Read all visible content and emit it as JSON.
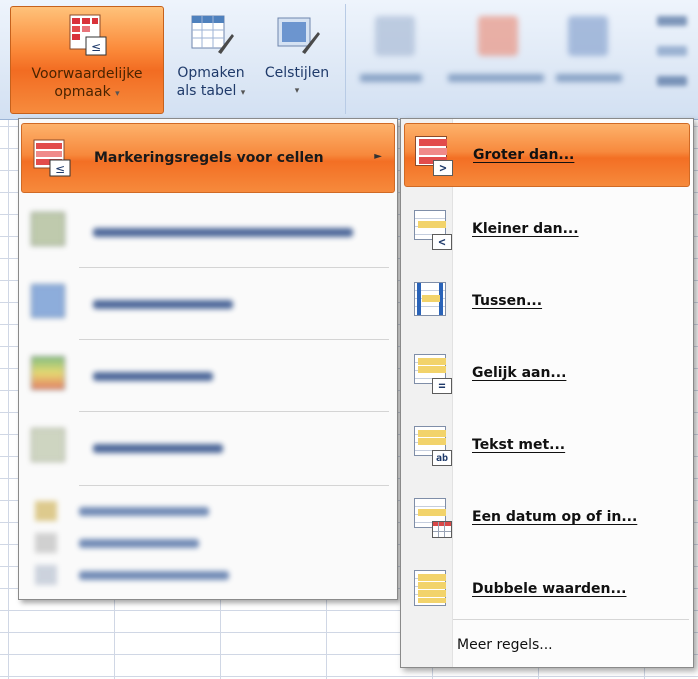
{
  "ribbon": {
    "conditional_formatting": {
      "line1": "Voorwaardelijke",
      "line2": "opmaak"
    },
    "format_as_table": {
      "line1": "Opmaken",
      "line2": "als tabel"
    },
    "cell_styles": {
      "line1": "Celstijlen",
      "line2": ""
    },
    "caret": "▾"
  },
  "menu": {
    "items": [
      {
        "label": "Markeringsregels voor cellen",
        "icon": "highlight-rules-icon",
        "state": "active"
      }
    ],
    "submenu_arrow": "►"
  },
  "submenu": {
    "items": [
      {
        "label": "Groter dan...",
        "icon": "greater-than-icon",
        "badge": ">"
      },
      {
        "label": "Kleiner dan...",
        "icon": "less-than-icon",
        "badge": "<"
      },
      {
        "label": "Tussen...",
        "icon": "between-icon",
        "badge": ""
      },
      {
        "label": "Gelijk aan...",
        "icon": "equal-to-icon",
        "badge": "="
      },
      {
        "label": "Tekst met...",
        "icon": "text-contains-icon",
        "badge": "ab"
      },
      {
        "label": "Een datum op of in...",
        "icon": "date-occurring-icon",
        "badge": ""
      },
      {
        "label": "Dubbele waarden...",
        "icon": "duplicate-values-icon",
        "badge": ""
      }
    ],
    "more": "Meer regels..."
  },
  "colors": {
    "highlight_orange": "#f36f24",
    "ribbon_blue": "#dfe9f6",
    "text_dark": "#111111"
  }
}
